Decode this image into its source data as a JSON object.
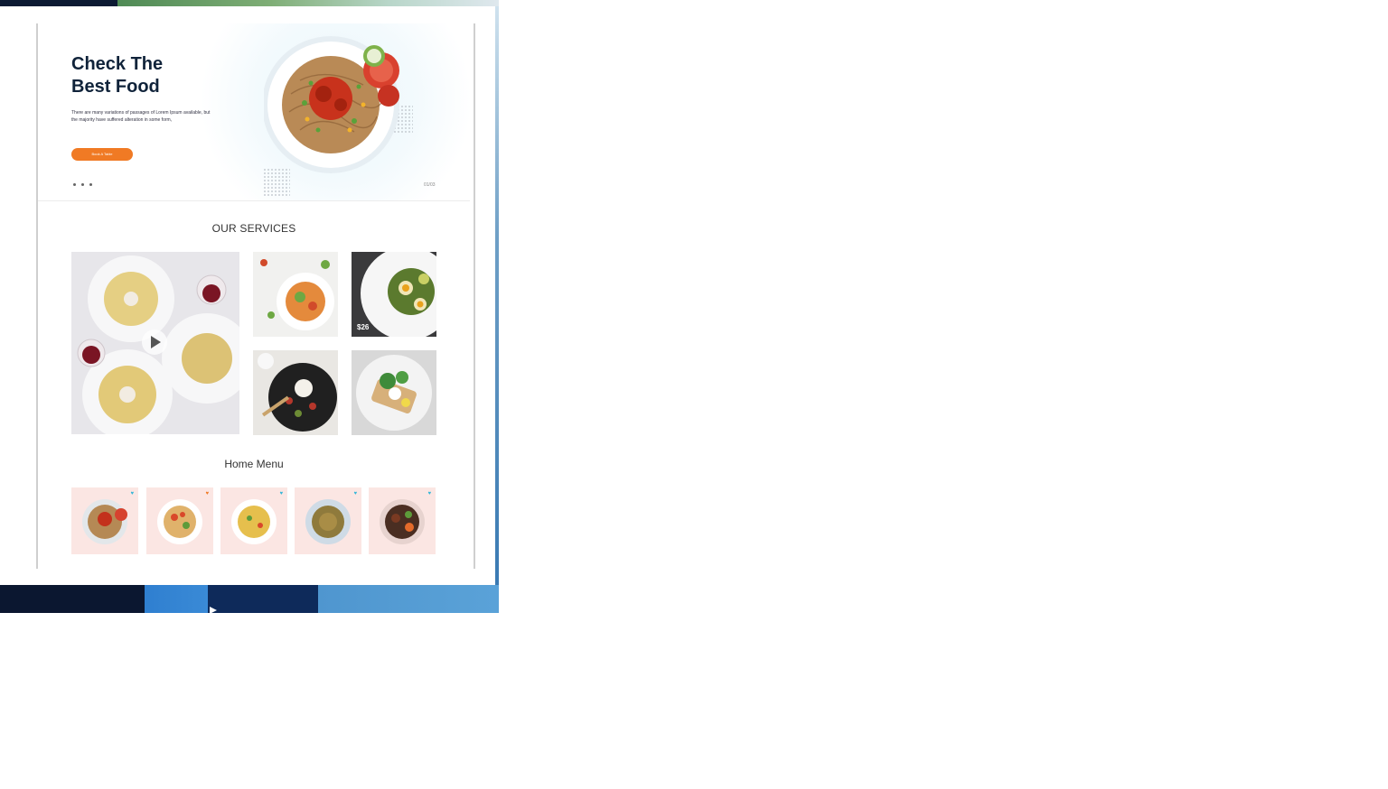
{
  "hero": {
    "title_line1": "Check The",
    "title_line2": "Best Food",
    "description": "There are many variations of passages of Lorem Ipsum available, but the majority have suffered alteration in some form,",
    "cta_label": "Book A Table",
    "slide_counter": "01/03"
  },
  "services": {
    "title": "OUR SERVICES",
    "price_label": "$26"
  },
  "menu": {
    "title": "Home Menu",
    "items": [
      {
        "heart_color": "#34b6d8",
        "dish": "spaghetti"
      },
      {
        "heart_color": "#f07a24",
        "dish": "penne-veg"
      },
      {
        "heart_color": "#34b6d8",
        "dish": "pasta-corn"
      },
      {
        "heart_color": "#34b6d8",
        "dish": "noodles"
      },
      {
        "heart_color": "#34b6d8",
        "dish": "beef-bowl"
      }
    ]
  },
  "colors": {
    "accent": "#f07a24",
    "heading": "#10233a",
    "menu_card_bg": "#fbe6e3"
  }
}
